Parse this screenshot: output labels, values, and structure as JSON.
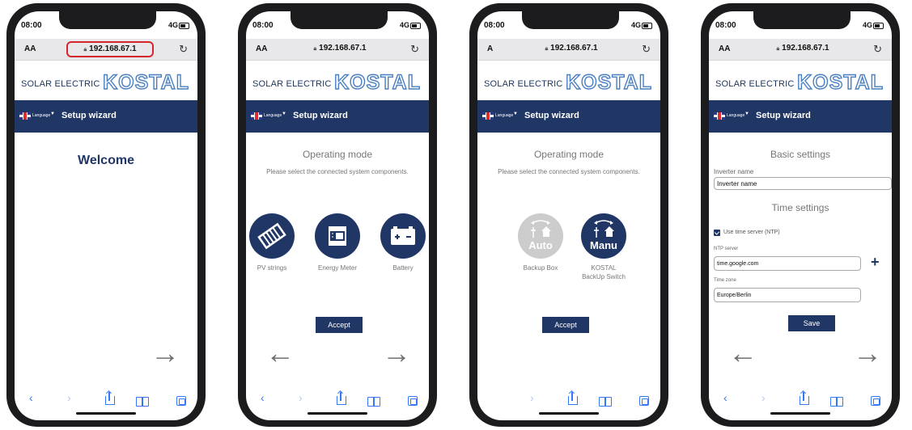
{
  "status_bar": {
    "time": "08:00",
    "signal": "4G"
  },
  "browser": {
    "font_size_label": "AA",
    "font_size_label_3": "A",
    "url": "192.168.67.1"
  },
  "header": {
    "brand_prefix": "SOLAR ELECTRIC",
    "brand_name": "KOSTAL",
    "language_label": "Language",
    "title": "Setup wizard"
  },
  "screen1": {
    "heading": "Welcome"
  },
  "screen2": {
    "heading": "Operating mode",
    "subtitle": "Please select the connected system components.",
    "components": [
      {
        "label": "PV strings",
        "icon": "pv-panel-icon"
      },
      {
        "label": "Energy Meter",
        "icon": "energy-meter-icon"
      },
      {
        "label": "Battery",
        "icon": "battery-icon"
      }
    ],
    "accept": "Accept"
  },
  "screen3": {
    "heading": "Operating mode",
    "subtitle": "Please select the connected system components.",
    "options": [
      {
        "label": "Backup Box",
        "word": "Auto",
        "state": "unselected"
      },
      {
        "label_line1": "KOSTAL",
        "label_line2": "BackUp Switch",
        "word": "Manu",
        "state": "selected"
      }
    ],
    "accept": "Accept"
  },
  "screen4": {
    "basic_heading": "Basic settings",
    "inverter_label": "Inverter name",
    "inverter_value": "Inverter name",
    "time_heading": "Time settings",
    "ntp_checkbox": "Use time server (NTP)",
    "ntp_checked": true,
    "ntp_label": "NTP server",
    "ntp_value": "time.google.com",
    "tz_label": "Time zone",
    "tz_value": "Europe/Berlin",
    "save": "Save"
  },
  "colors": {
    "navy": "#203766",
    "logo_blue": "#4a7fc1",
    "url_highlight": "#d7262b",
    "toolbar_blue": "#3478f6"
  }
}
